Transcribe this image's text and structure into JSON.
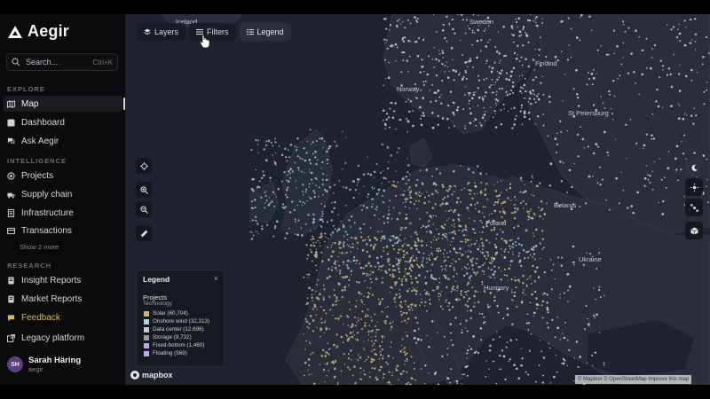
{
  "app": {
    "name": "Aegir"
  },
  "search": {
    "placeholder": "Search...",
    "shortcut": "Ctrl+K"
  },
  "sidebar": {
    "sections": [
      {
        "label": "EXPLORE",
        "items": [
          {
            "label": "Map",
            "icon": "map-icon",
            "active": true
          },
          {
            "label": "Dashboard",
            "icon": "dashboard-icon"
          },
          {
            "label": "Ask Aegir",
            "icon": "chat-icon"
          }
        ]
      },
      {
        "label": "INTELLIGENCE",
        "items": [
          {
            "label": "Projects",
            "icon": "target-icon"
          },
          {
            "label": "Supply chain",
            "icon": "supply-chain-icon"
          },
          {
            "label": "Infrastructure",
            "icon": "infrastructure-icon"
          },
          {
            "label": "Transactions",
            "icon": "transactions-icon"
          }
        ],
        "show_more": "Show 2 more"
      },
      {
        "label": "RESEARCH",
        "items": [
          {
            "label": "Insight Reports",
            "icon": "report-icon"
          },
          {
            "label": "Market Reports",
            "icon": "report-icon"
          },
          {
            "label": "Feedback",
            "icon": "feedback-icon",
            "accent": "#e0b650"
          }
        ]
      }
    ],
    "legacy": {
      "label": "Legacy platform",
      "icon": "external-link-icon"
    }
  },
  "user": {
    "name": "Sarah Häring",
    "org": "aegir",
    "initials": "SH"
  },
  "map": {
    "tabs": [
      {
        "label": "Layers",
        "icon": "layers-icon"
      },
      {
        "label": "Filters",
        "icon": "filters-icon"
      },
      {
        "label": "Legend",
        "icon": "legend-icon",
        "active": true
      }
    ],
    "labels": {
      "iceland": "Iceland",
      "sweden": "Sweden",
      "norway": "Norway",
      "finland": "Finland",
      "st_petersburg": "St Petersburg",
      "belarus": "Belarus",
      "poland": "Poland",
      "ukraine": "Ukraine",
      "hungary": "Hungary"
    },
    "legend": {
      "title": "Legend",
      "close": "×",
      "group": "Projects",
      "subgroup": "Technology",
      "items": [
        {
          "label": "Solar (60,704)",
          "color": "#c8b57a"
        },
        {
          "label": "Onshore wind (32,313)",
          "color": "#9fd3ea"
        },
        {
          "label": "Data center (12,696)",
          "color": "#c9c9c9"
        },
        {
          "label": "Storage (9,732)",
          "color": "#9a9a9a"
        },
        {
          "label": "Fixed-bottom (1,460)",
          "color": "#b9a8df"
        },
        {
          "label": "Floating (569)",
          "color": "#c8a8e8"
        }
      ]
    },
    "mapbox": "mapbox",
    "attribution": "© Mapbox © OpenStreetMap  Improve this map"
  },
  "colors": {
    "water": "#1f2330",
    "land": "#2a2e3b",
    "accent": "#e0b650"
  }
}
